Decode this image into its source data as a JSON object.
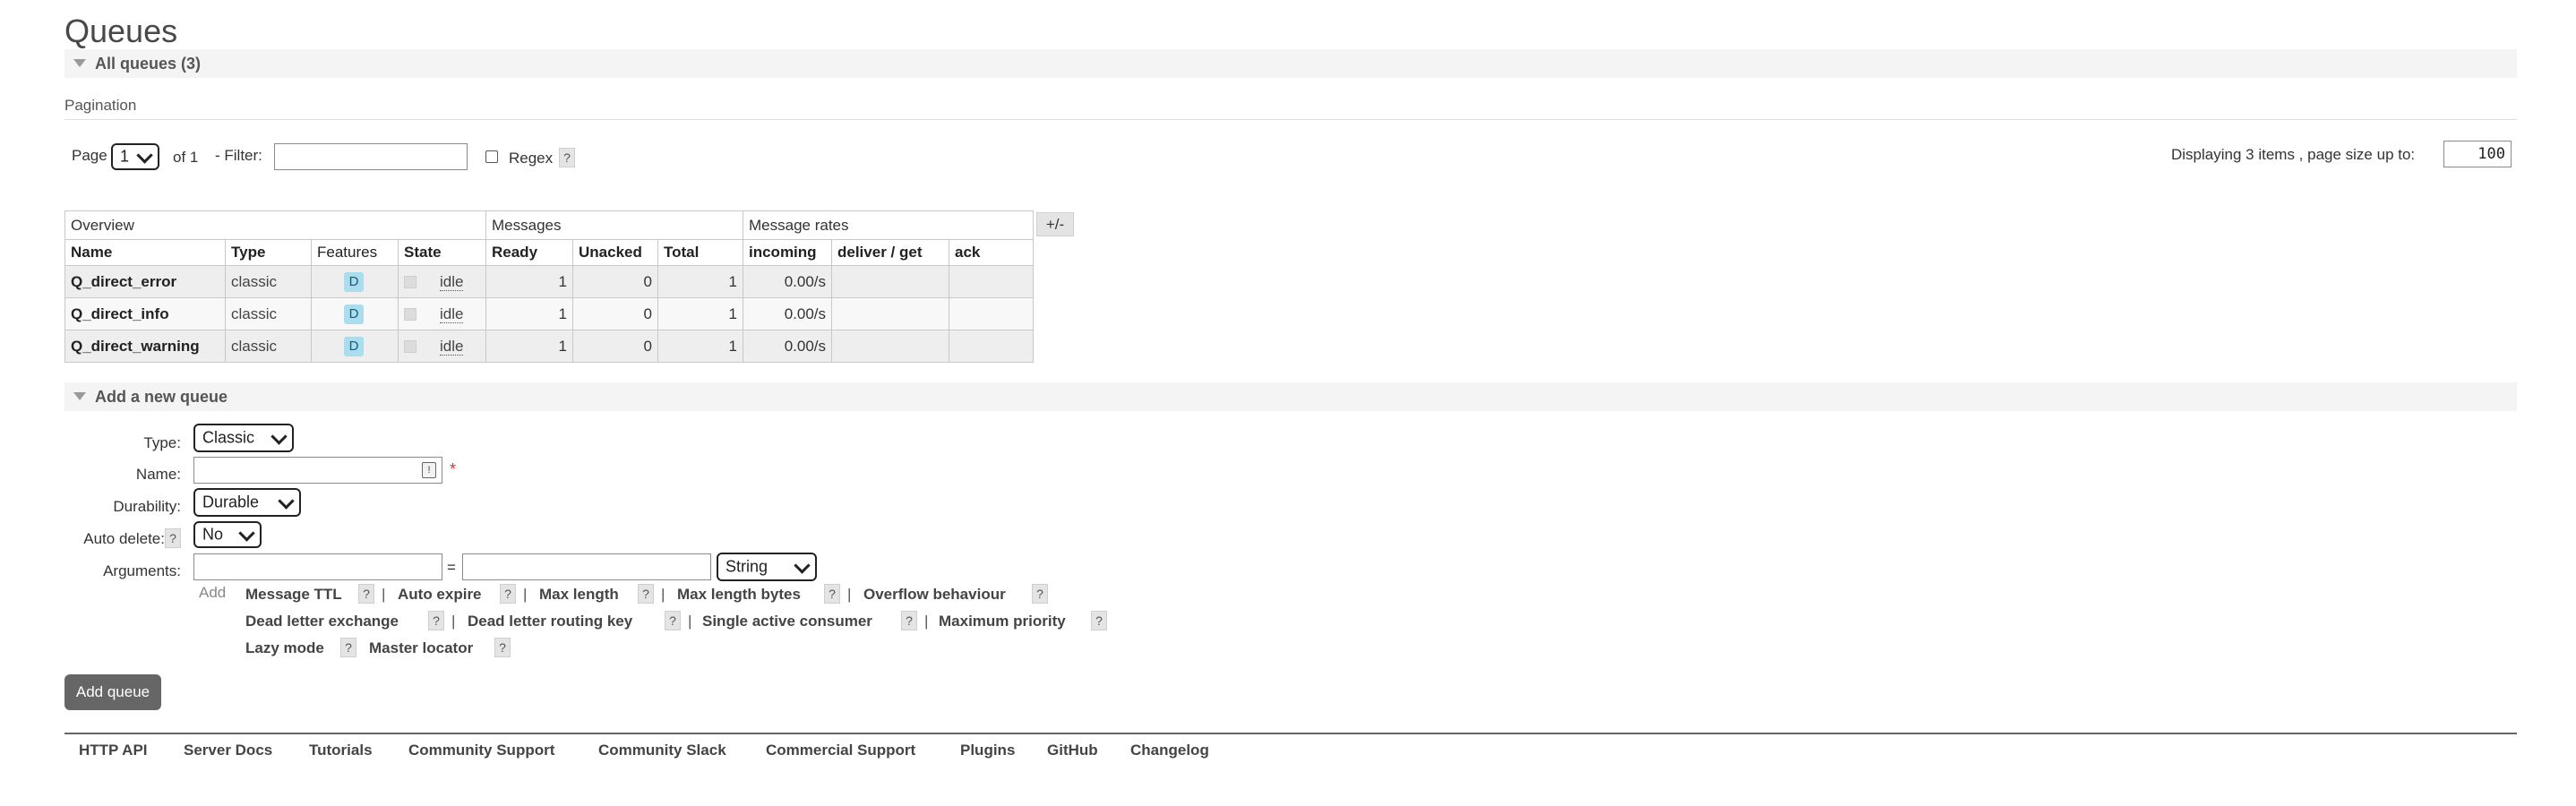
{
  "page_title": "Queues",
  "all_queues": {
    "label": "All queues (3)"
  },
  "pagination": {
    "heading": "Pagination",
    "page_label": "Page",
    "page_value": "1",
    "of_label": "of 1",
    "filter_label": "- Filter:",
    "filter_value": "",
    "regex_label": "Regex",
    "regex_help": "?",
    "display_text": "Displaying 3 items , page size up to:",
    "page_size": "100"
  },
  "table": {
    "group_headers": [
      "Overview",
      "Messages",
      "Message rates"
    ],
    "toggle_label": "+/-",
    "columns": [
      "Name",
      "Type",
      "Features",
      "State",
      "Ready",
      "Unacked",
      "Total",
      "incoming",
      "deliver / get",
      "ack"
    ],
    "rows": [
      {
        "name": "Q_direct_error",
        "type": "classic",
        "feature": "D",
        "state": "idle",
        "ready": "1",
        "unacked": "0",
        "total": "1",
        "incoming": "0.00/s",
        "deliver_get": "",
        "ack": ""
      },
      {
        "name": "Q_direct_info",
        "type": "classic",
        "feature": "D",
        "state": "idle",
        "ready": "1",
        "unacked": "0",
        "total": "1",
        "incoming": "0.00/s",
        "deliver_get": "",
        "ack": ""
      },
      {
        "name": "Q_direct_warning",
        "type": "classic",
        "feature": "D",
        "state": "idle",
        "ready": "1",
        "unacked": "0",
        "total": "1",
        "incoming": "0.00/s",
        "deliver_get": "",
        "ack": ""
      }
    ]
  },
  "add_queue": {
    "section_label": "Add a new queue",
    "type_label": "Type:",
    "type_value": "Classic",
    "name_label": "Name:",
    "name_value": "",
    "required_mark": "*",
    "durability_label": "Durability:",
    "durability_value": "Durable",
    "auto_delete_label": "Auto delete:",
    "auto_delete_help": "?",
    "auto_delete_value": "No",
    "arguments_label": "Arguments:",
    "arg_key_value": "",
    "equals": "=",
    "arg_val_value": "",
    "arg_type_value": "String",
    "add_label": "Add",
    "help": "?",
    "separator": "|",
    "arg_links": [
      "Message TTL",
      "Auto expire",
      "Max length",
      "Max length bytes",
      "Overflow behaviour",
      "Dead letter exchange",
      "Dead letter routing key",
      "Single active consumer",
      "Maximum priority",
      "Lazy mode",
      "Master locator"
    ],
    "button_label": "Add queue"
  },
  "footer": {
    "links": [
      "HTTP API",
      "Server Docs",
      "Tutorials",
      "Community Support",
      "Community Slack",
      "Commercial Support",
      "Plugins",
      "GitHub",
      "Changelog"
    ]
  }
}
